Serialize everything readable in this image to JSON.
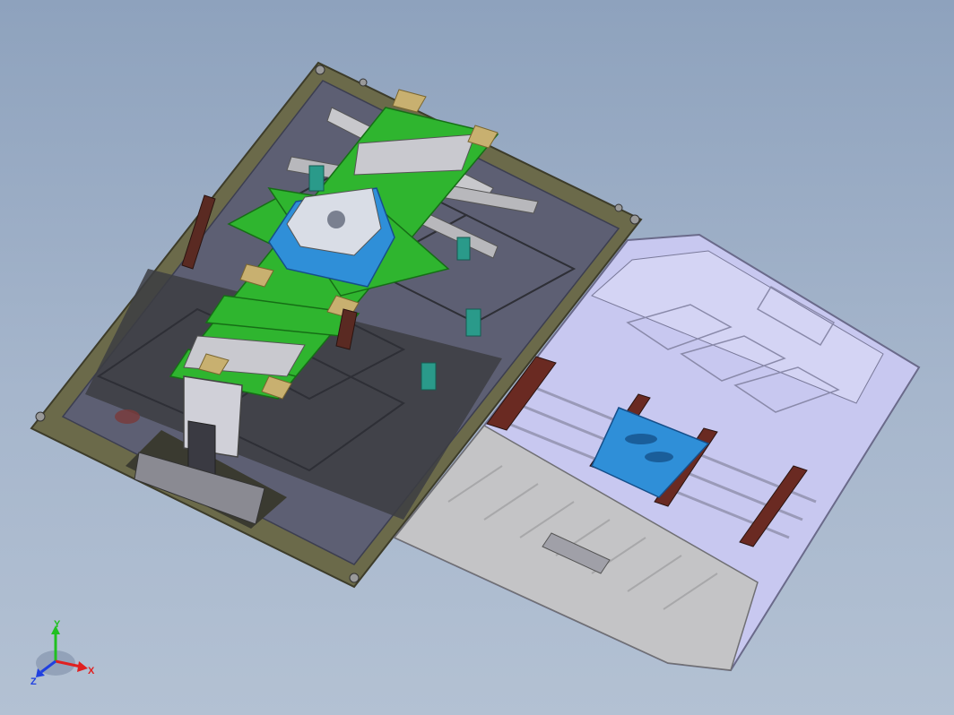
{
  "viewport": {
    "background_top": "#8ea2bd",
    "background_bottom": "#b3c1d3"
  },
  "model": {
    "left_fixture": {
      "base_plate_color": "#6b6a4a",
      "tray_color": "#5a5c70",
      "frame_color": "#2fb52f",
      "rotary_table_color": "#2f8fd8",
      "clamp_color": "#5a2a22"
    },
    "right_part": {
      "body_color": "#c8c8f0",
      "floor_color": "#c4c4c6",
      "bracket_color": "#2f8fd8",
      "clamp_color": "#6a2a22"
    }
  },
  "triad": {
    "x_label": "X",
    "y_label": "Y",
    "z_label": "Z",
    "x_color": "#e02020",
    "y_color": "#20c020",
    "z_color": "#2040e0"
  }
}
